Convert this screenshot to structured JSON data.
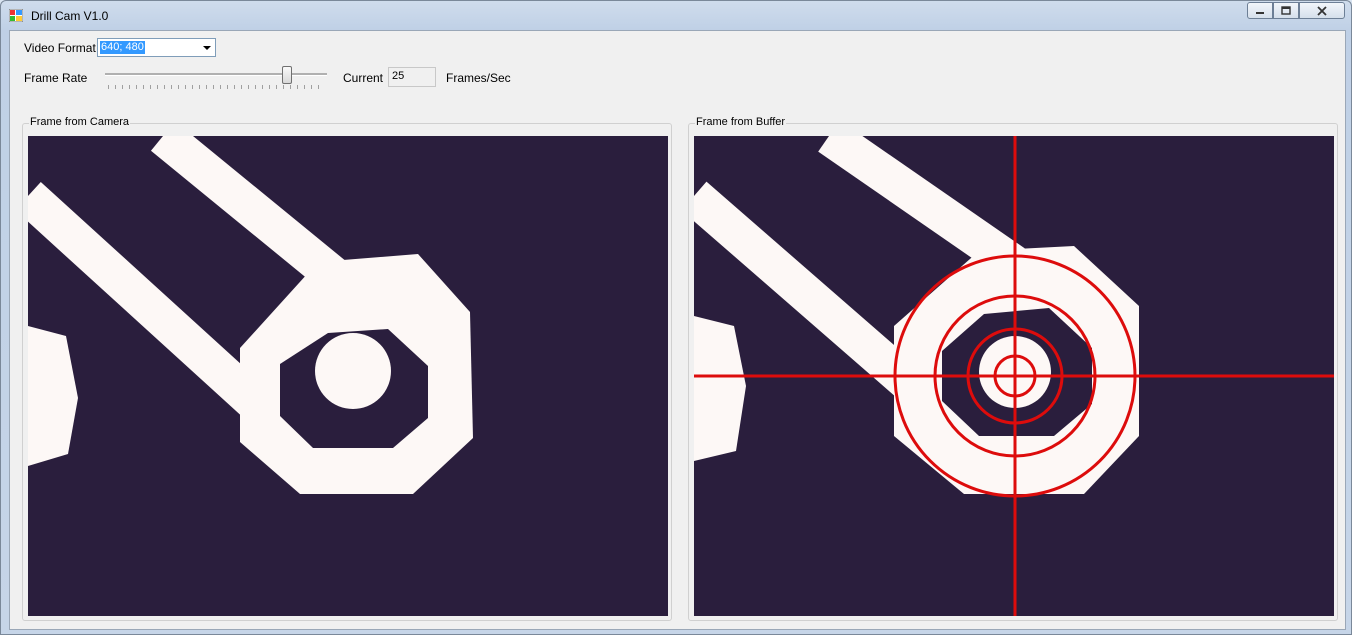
{
  "window": {
    "title": "Drill Cam V1.0"
  },
  "controls": {
    "video_format_label": "Video Format",
    "video_format_value": "640; 480",
    "frame_rate_label": "Frame Rate",
    "frame_rate_slider_fraction": 0.82,
    "current_label": "Current",
    "current_value": "25",
    "unit_label": "Frames/Sec"
  },
  "panels": {
    "camera_title": "Frame from Camera",
    "buffer_title": "Frame from Buffer"
  },
  "colors": {
    "pcb_background": "#2a1e3d",
    "copper_trace": "#fdf8f6",
    "crosshair": "#dd0c0c"
  },
  "icons": [
    "app-icon",
    "minimize-icon",
    "maximize-icon",
    "close-icon"
  ]
}
